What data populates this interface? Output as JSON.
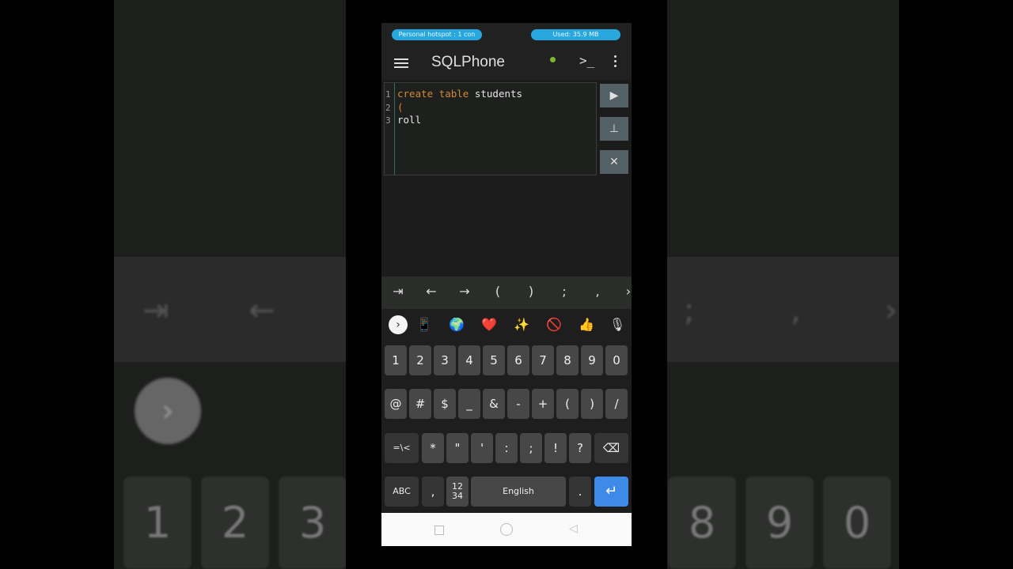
{
  "status": {
    "hotspot": "Personal hotspot : 1 con",
    "data_used": "Used: 35.9 MB"
  },
  "appbar": {
    "title": "SQLPhone",
    "console_glyph": ">_",
    "status_color": "#7cb82f"
  },
  "editor": {
    "line_numbers": [
      "1",
      "2",
      "3"
    ],
    "lines": [
      {
        "keyword1": "create",
        "keyword2": "table",
        "text": "students"
      },
      {
        "text": "("
      },
      {
        "text": "roll"
      }
    ]
  },
  "side_buttons": {
    "run": "▶",
    "format": "⊥",
    "clear": "✕"
  },
  "symbol_bar": [
    "⇥",
    "←",
    "→",
    "(",
    ")",
    ";",
    ",",
    "›"
  ],
  "suggestions": {
    "expand": "›",
    "items": [
      "📱",
      "🌍",
      "❤️",
      "✨",
      "🚫",
      "👍",
      "🎙"
    ]
  },
  "keyboard": {
    "row1": [
      "1",
      "2",
      "3",
      "4",
      "5",
      "6",
      "7",
      "8",
      "9",
      "0"
    ],
    "row2": [
      "@",
      "#",
      "$",
      "_",
      "&",
      "-",
      "+",
      "(",
      ")",
      "/"
    ],
    "row3": [
      "=\\<",
      "*",
      "\"",
      "'",
      ":",
      ";",
      "!",
      "?",
      "⌫"
    ],
    "row4": {
      "abc": "ABC",
      "comma": ",",
      "numpad": "12\n34",
      "space": "English",
      "period": ".",
      "enter": "↵"
    }
  },
  "background": {
    "keys": [
      "1",
      "2",
      "3",
      "8",
      "9",
      "0"
    ]
  }
}
